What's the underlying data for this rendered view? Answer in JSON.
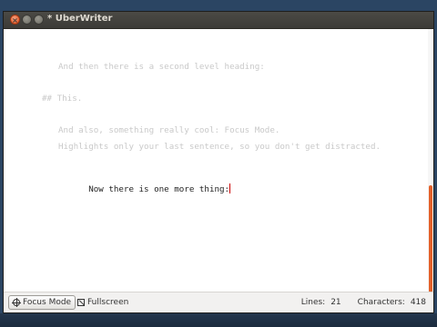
{
  "window": {
    "title": "* UberWriter"
  },
  "editor": {
    "lines": [
      {
        "text": "And then there is a second level heading:",
        "state": "dim"
      },
      {
        "text": "## This.",
        "state": "dim"
      },
      {
        "text": "And also, something really cool: Focus Mode.",
        "state": "dim"
      },
      {
        "text": "Highlights only your last sentence, so you don't get distracted.",
        "state": "dim"
      },
      {
        "text": "Now there is one more thing:",
        "state": "active"
      }
    ]
  },
  "statusbar": {
    "focus_mode_label": "Focus Mode",
    "fullscreen_label": "Fullscreen",
    "lines_label": "Lines:",
    "lines_value": "21",
    "characters_label": "Characters:",
    "characters_value": "418"
  },
  "colors": {
    "active_text": "#1f1f1f",
    "dim_text": "#c9c9c9",
    "cursor": "#cc0000",
    "scrollbar_thumb": "#e3622b",
    "titlebar": "#3c3b37"
  }
}
